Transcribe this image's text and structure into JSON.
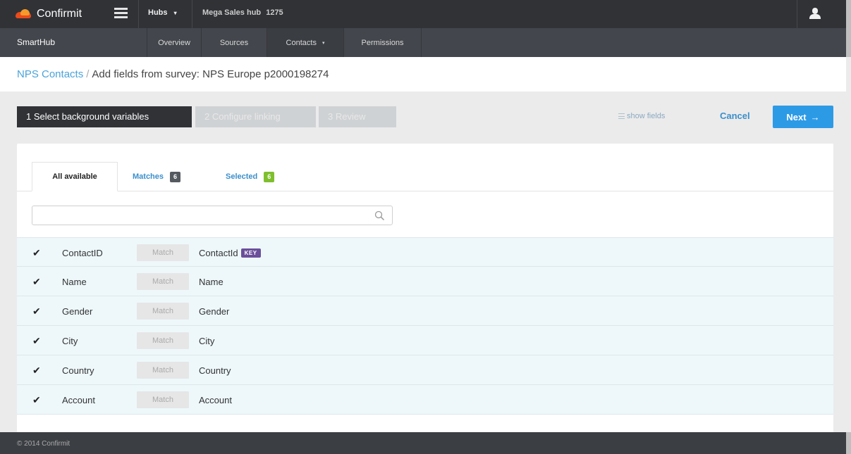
{
  "topbar": {
    "brand": "Confirmit",
    "hubs_label": "Hubs",
    "hubs_caret": "▾",
    "hub_name": "Mega Sales hub",
    "hub_id": "1275"
  },
  "subbar": {
    "title": "SmartHub",
    "nav": [
      {
        "label": "Overview"
      },
      {
        "label": "Sources"
      },
      {
        "label": "Contacts",
        "caret": "▾"
      },
      {
        "label": "Permissions"
      }
    ]
  },
  "breadcrumb": {
    "link": "NPS Contacts",
    "separator": "/",
    "current": "Add fields from survey: NPS Europe p2000198274"
  },
  "wizard": {
    "steps": [
      {
        "label": "1 Select background variables"
      },
      {
        "label": "2 Configure linking"
      },
      {
        "label": "3 Review"
      }
    ],
    "show_fields": "show fields",
    "cancel": "Cancel",
    "next": "Next",
    "next_arrow": "→"
  },
  "tabs": {
    "all": "All available",
    "matches": {
      "label": "Matches",
      "count": "6"
    },
    "selected": {
      "label": "Selected",
      "count": "6"
    }
  },
  "search": {
    "value": "",
    "placeholder": ""
  },
  "rows": [
    {
      "field": "ContactID",
      "match": "Match",
      "target": "ContactId",
      "key": "KEY"
    },
    {
      "field": "Name",
      "match": "Match",
      "target": "Name"
    },
    {
      "field": "Gender",
      "match": "Match",
      "target": "Gender"
    },
    {
      "field": "City",
      "match": "Match",
      "target": "City"
    },
    {
      "field": "Country",
      "match": "Match",
      "target": "Country"
    },
    {
      "field": "Account",
      "match": "Match",
      "target": "Account"
    }
  ],
  "footer": {
    "copyright": "© 2014 Confirmit"
  },
  "colors": {
    "primary": "#2d9ae6",
    "link": "#4aa3d9",
    "key_badge": "#6b4f9a",
    "selected_badge": "#7fbf2e",
    "topbar": "#303236"
  },
  "icons": [
    "confirmit-logo-icon",
    "hamburger-menu-icon",
    "user-icon",
    "list-icon",
    "search-icon",
    "checkmark-icon"
  ]
}
